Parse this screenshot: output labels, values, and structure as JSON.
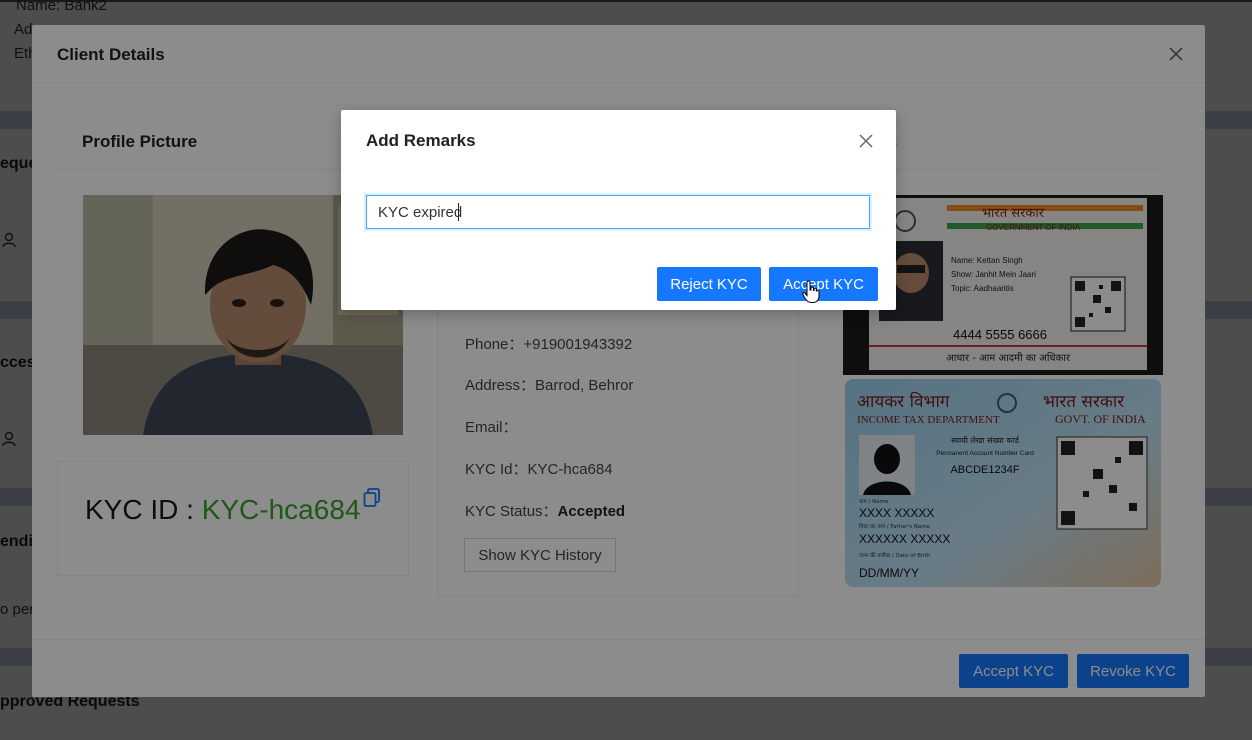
{
  "background": {
    "name_line": "Name: Bank2",
    "addr_fragment": "Ad",
    "eth_fragment": "Eth",
    "requests_fragment": "eque",
    "access_fragment": "cces",
    "pending_fragment": "endi",
    "no_pending_fragment": "o pen",
    "approved_heading": "pproved Requests"
  },
  "client_modal": {
    "title": "Client Details",
    "profile_title": "Profile Picture",
    "documents_title_fragment": "ments",
    "kyc_id_label": "KYC ID : ",
    "kyc_id_value": "KYC-hca684",
    "info": {
      "phone_label": "Phone：",
      "phone_value": "+919001943392",
      "address_label": "Address：",
      "address_value": "Barrod, Behror",
      "email_label": "Email：",
      "email_value": "",
      "kyc_id_label": "KYC Id：",
      "kyc_id_value": "KYC-hca684",
      "status_label": "KYC Status：",
      "status_value": "Accepted"
    },
    "history_button": "Show KYC History",
    "accept_button": "Accept KYC",
    "revoke_button": "Revoke KYC",
    "aadhaar": {
      "header_hindi": "भारत सरकार",
      "header_en": "GOVERNMENT OF INDIA",
      "name": "Name: Kettan Singh",
      "show": "Show: Janhit Mein Jaari",
      "topic": "Topic: Aadhaaritis",
      "number": "4444  5555  6666",
      "footer": "आधार - आम आदमी का अधिकार"
    },
    "pan": {
      "dept_hindi": "आयकर विभाग",
      "govt_hindi": "भारत सरकार",
      "dept_en": "INCOME TAX DEPARTMENT",
      "govt_en": "GOVT. OF INDIA",
      "card_hindi": "स्थायी लेखा संख्या कार्ड",
      "card_en": "Permanent Account Number Card",
      "pan_number": "ABCDE1234F",
      "name_label": "नाम / Name",
      "name": "XXXX XXXXX",
      "father_label": "पिता का नाम / Father's Name",
      "father": "XXXXXX XXXXX",
      "dob_label": "जन्म की तारीख / Date of Birth",
      "dob": "DD/MM/YY"
    }
  },
  "remarks_modal": {
    "title": "Add Remarks",
    "input_value": "KYC expired",
    "reject_button": "Reject KYC",
    "accept_button": "Accept KYC"
  },
  "colors": {
    "primary": "#1677ff",
    "kyc_green": "#3aa12d"
  }
}
